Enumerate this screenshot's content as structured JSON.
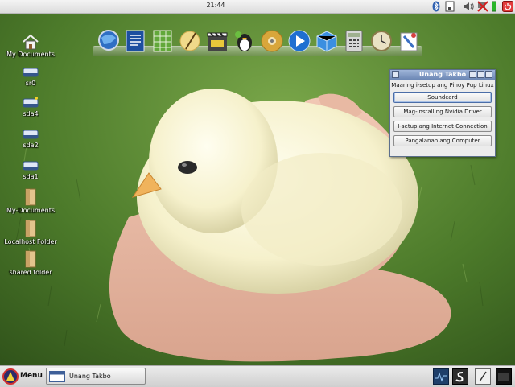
{
  "top_panel": {
    "clock": "21:44",
    "tray_icons": [
      "bluetooth-icon",
      "network-icon",
      "volume-icon",
      "network-off-icon",
      "battery-icon",
      "power-icon"
    ]
  },
  "dock": {
    "icons": [
      "browser-globe-icon",
      "text-document-icon",
      "spreadsheet-icon",
      "feather-pen-icon",
      "clapperboard-icon",
      "chat-penguin-icon",
      "dvd-disc-icon",
      "media-play-icon",
      "cube-icon",
      "calculator-icon",
      "clock-settings-icon",
      "paint-palette-icon"
    ]
  },
  "desktop": {
    "icons": [
      {
        "label": "My Documents",
        "icon": "home-icon"
      },
      {
        "label": "sr0",
        "icon": "drive-icon"
      },
      {
        "label": "sda4",
        "icon": "drive-icon"
      },
      {
        "label": "sda2",
        "icon": "drive-icon"
      },
      {
        "label": "sda1",
        "icon": "drive-icon"
      },
      {
        "label": "My-Documents",
        "icon": "folder-icon"
      },
      {
        "label": "Localhost Folder",
        "icon": "folder-icon"
      },
      {
        "label": "shared folder",
        "icon": "folder-icon"
      }
    ]
  },
  "dialog": {
    "title": "Unang Takbo",
    "prompt": "Maaring i-setup ang Pinoy Pup Linux",
    "buttons": [
      {
        "label": "Soundcard"
      },
      {
        "label": "Mag-install ng Nvidia Driver"
      },
      {
        "label": "I-setup ang Internet Connection"
      },
      {
        "label": "Pangalanan ang Computer"
      }
    ]
  },
  "taskbar": {
    "menu_label": "Menu",
    "task_label": "Unang Takbo",
    "tray_icons": [
      "system-monitor-icon",
      "terminal-icon",
      "text-editor-icon",
      "show-desktop-icon"
    ]
  },
  "colors": {
    "grass": "#3f6a22",
    "titlebar": "#6c87b4",
    "dialog_bg": "#ececec"
  }
}
